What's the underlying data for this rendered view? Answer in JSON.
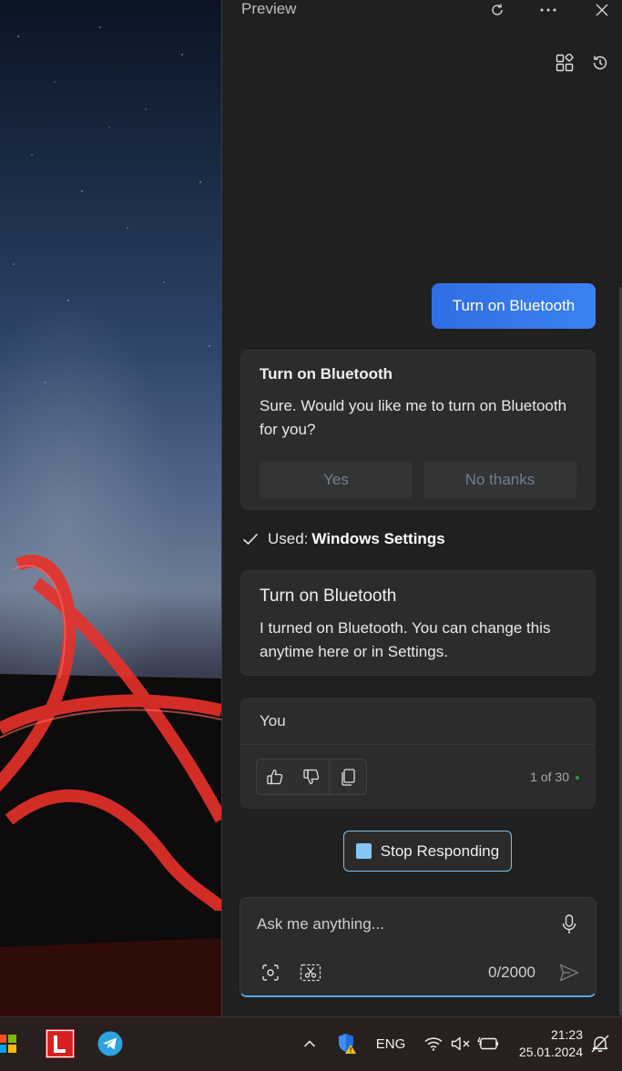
{
  "window": {
    "title": "Preview",
    "refresh_icon": "refresh-icon",
    "more_icon": "more-icon",
    "close_icon": "close-icon"
  },
  "toolbar": {
    "plugins_icon": "plugins-icon",
    "history_icon": "history-icon"
  },
  "conversation": {
    "user_message": "Turn on Bluetooth",
    "confirm_card": {
      "title": "Turn on Bluetooth",
      "body": "Sure. Would you like me to turn on Bluetooth for you?",
      "yes_label": "Yes",
      "no_label": "No thanks"
    },
    "used": {
      "prefix": "Used:",
      "source": "Windows Settings"
    },
    "result_card": {
      "title": "Turn on Bluetooth",
      "body": "I turned on Bluetooth. You can change this anytime here or in Settings."
    },
    "response_card": {
      "author": "You",
      "counter": "1 of 30",
      "counter_dot_color": "#2d9d3a"
    }
  },
  "stop_button": {
    "label": "Stop Responding"
  },
  "composer": {
    "placeholder": "Ask me anything...",
    "char_count": "0/2000"
  },
  "taskbar": {
    "language": "ENG",
    "time": "21:23",
    "date": "25.01.2024"
  },
  "colors": {
    "accent": "#3b82f0",
    "stop_accent": "#86c6f5",
    "panel_bg": "#202020",
    "card_bg": "#2c2c2c"
  }
}
